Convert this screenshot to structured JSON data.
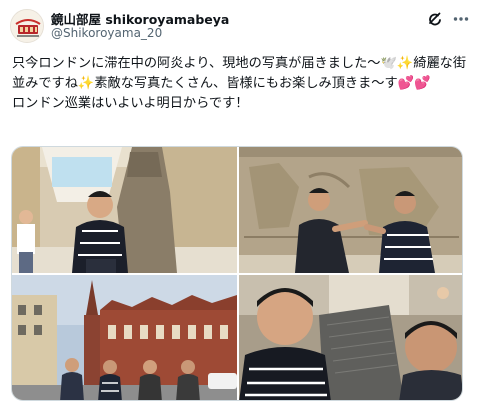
{
  "author": {
    "display_name": "鏡山部屋 shikoroyamabeya",
    "handle": "@Shikoroyama_20",
    "avatar_icon": "stable-logo-icon"
  },
  "actions": {
    "grok_icon": "grok-icon",
    "more_icon": "more-options-icon"
  },
  "tweet": {
    "line1": "只今ロンドンに滞在中の阿炎より、現地の写真が届きました～🕊️✨綺麗な街並みですね✨素敵な写真たくさん、皆様にもお楽しみ頂きま～す💕💕",
    "line2": "ロンドン巡業はいよいよ明日からです！"
  },
  "colors": {
    "text": "#0f1419",
    "secondary": "#536471",
    "border": "#cfd9de"
  }
}
